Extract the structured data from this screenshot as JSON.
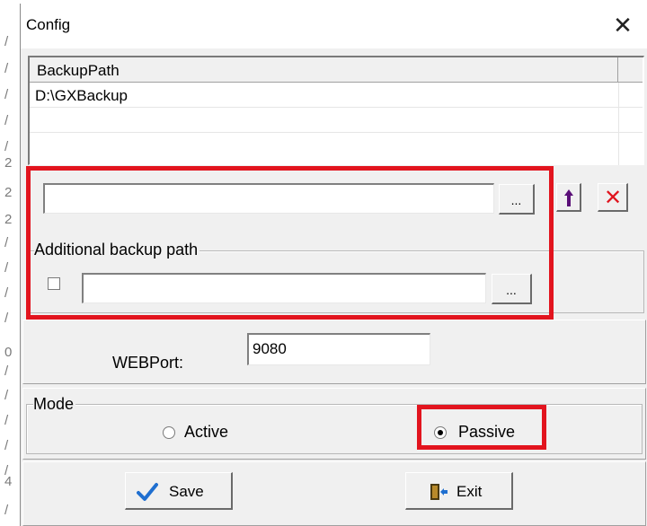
{
  "background": {
    "chars": [
      "/",
      "/",
      "/",
      "/",
      "/",
      "2",
      "2",
      "2",
      "/",
      "/",
      "/",
      "/",
      "0",
      "/",
      "/",
      "/",
      "/",
      "/",
      "4",
      "/"
    ]
  },
  "window": {
    "title": "Config",
    "close_glyph": "✕"
  },
  "backup_list": {
    "column_header": "BackupPath",
    "rows": [
      "D:\\GXBackup",
      "",
      ""
    ]
  },
  "path_input": {
    "value": "",
    "browse_label": "...",
    "up_icon": "arrow-up-icon",
    "delete_icon": "delete-icon",
    "delete_glyph": "✕"
  },
  "additional_backup": {
    "group_label": "Additional backup path",
    "checked": false,
    "value": "",
    "browse_label": "..."
  },
  "web": {
    "label": "WEBPort:",
    "value": "9080"
  },
  "mode": {
    "group_label": "Mode",
    "options": [
      "Active",
      "Passive"
    ],
    "selected": "Passive"
  },
  "buttons": {
    "save_label": "Save",
    "exit_label": "Exit"
  },
  "colors": {
    "highlight": "#e2141e",
    "up_arrow": "#5a0f78",
    "delete_x": "#e0141e",
    "save_check": "#1f6fd0"
  }
}
